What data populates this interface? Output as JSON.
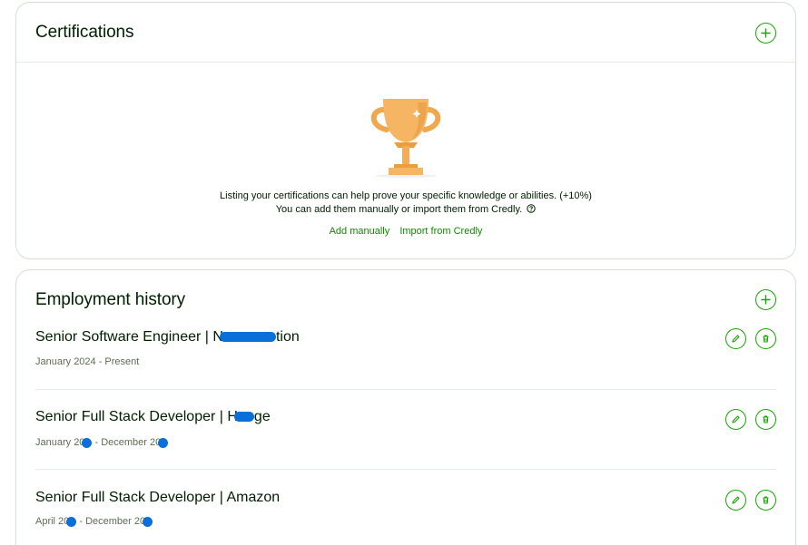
{
  "certifications": {
    "title": "Certifications",
    "empty_line1": "Listing your certifications can help prove your specific knowledge or abilities. (+10%)",
    "empty_line2": "You can add them manually or import them from Credly.",
    "add_manually": "Add manually",
    "import_credly": "Import from Credly"
  },
  "employment": {
    "title": "Employment history",
    "jobs": [
      {
        "title": "Senior Software Engineer | N",
        "title_tail": "tion",
        "dates": "January 2024 - Present"
      },
      {
        "title": "Senior Full Stack Developer | H",
        "title_tail": "ge",
        "dates_a": "January 20",
        "dates_b": " - December 20"
      },
      {
        "title": "Senior Full Stack Developer | Amazon",
        "dates_a": "April 20",
        "dates_b": " - December 20"
      }
    ]
  },
  "icons": {
    "add": "plus-icon",
    "edit": "pencil-icon",
    "delete": "trash-icon",
    "help": "question-circle-icon",
    "empty_state": "trophy-icon"
  },
  "colors": {
    "accent": "#14a800",
    "link": "#108a00",
    "text": "#001e00",
    "muted": "#5e6d55",
    "redaction": "#0a6fd8"
  }
}
